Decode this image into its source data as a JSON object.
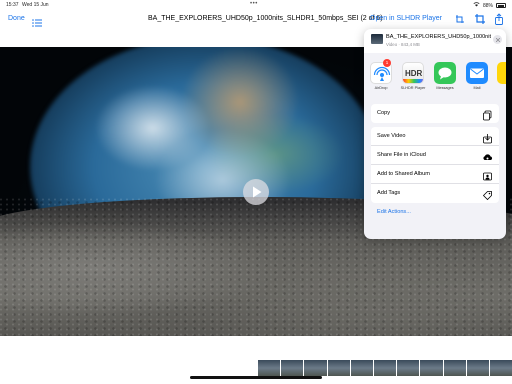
{
  "status_bar": {
    "time": "15:37",
    "date": "Wed 15 Jun",
    "battery": "88%"
  },
  "toolbar": {
    "done_label": "Done",
    "title": "BA_THE_EXPLORERS_UHD50p_1000nits_SLHDR1_50mbps_SEI (2 of 6)",
    "open_label": "Open in SLHDR Player",
    "icons": [
      "list-icon",
      "crop-rotate-icon",
      "crop-icon",
      "share-icon"
    ]
  },
  "player": {
    "play_icon": "play-icon"
  },
  "share_sheet": {
    "file_name": "BA_THE_EXPLORERS_UHD50p_1000nits_SLHDR1_50mbps_SEI",
    "file_meta": "Video · 843,4 MB",
    "apps": [
      {
        "label": "AirDrop",
        "badge": "1",
        "icon": "airdrop-icon"
      },
      {
        "label": "SLHDR Player",
        "icon": "hdr-app-icon",
        "icon_text": "HDR"
      },
      {
        "label": "Messages",
        "icon": "messages-icon"
      },
      {
        "label": "Mail",
        "icon": "mail-icon"
      }
    ],
    "group1": [
      {
        "label": "Copy",
        "icon": "copy-icon"
      }
    ],
    "group2": [
      {
        "label": "Save Video",
        "icon": "save-icon"
      },
      {
        "label": "Share File in iCloud",
        "icon": "icloud-share-icon"
      },
      {
        "label": "Add to Shared Album",
        "icon": "shared-album-icon"
      },
      {
        "label": "Add Tags",
        "icon": "tag-icon"
      }
    ],
    "edit_actions_label": "Edit Actions..."
  },
  "colors": {
    "accent": "#1a73e8",
    "badge": "#ff3b30",
    "messages": "#34c759",
    "mail": "#1f8bff"
  }
}
